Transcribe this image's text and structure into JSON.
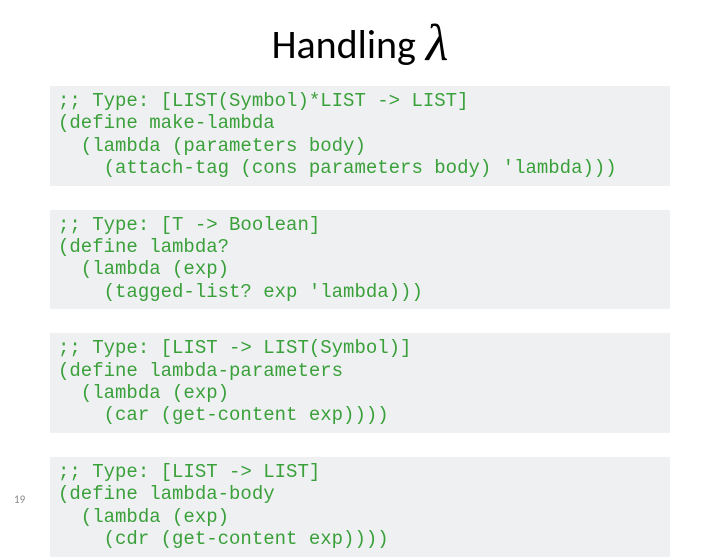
{
  "title": "Handling",
  "lambda_glyph": "λ",
  "code_blocks": [
    ";; Type: [LIST(Symbol)*LIST -> LIST]\n(define make-lambda\n  (lambda (parameters body)\n    (attach-tag (cons parameters body) 'lambda)))",
    ";; Type: [T -> Boolean]\n(define lambda?\n  (lambda (exp)\n    (tagged-list? exp 'lambda)))",
    ";; Type: [LIST -> LIST(Symbol)]\n(define lambda-parameters\n  (lambda (exp)\n    (car (get-content exp))))",
    ";; Type: [LIST -> LIST]\n(define lambda-body\n  (lambda (exp)\n    (cdr (get-content exp))))"
  ],
  "page_number": "19"
}
